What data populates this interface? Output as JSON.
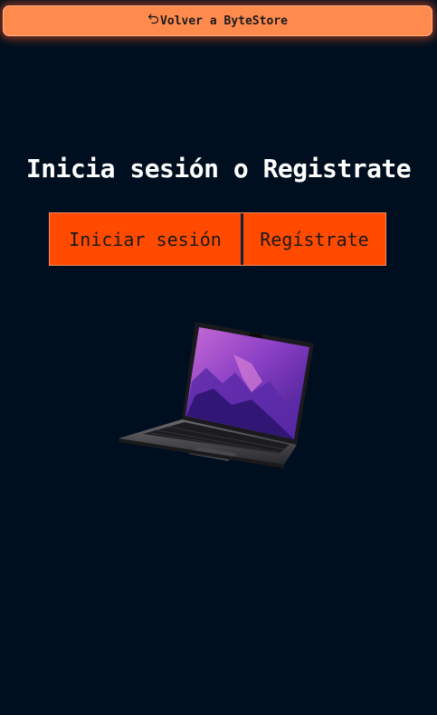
{
  "back_button": {
    "label": "Volver a ByteStore",
    "icon": "undo-arrow-icon"
  },
  "title": "Inicia sesión o Registrate",
  "auth_toggle": {
    "options": [
      {
        "label": "Iniciar sesión"
      },
      {
        "label": "Regístrate"
      }
    ]
  },
  "hero_image": {
    "subject": "laptop"
  },
  "colors": {
    "background": "#000f1f",
    "back_button": "#ff8a4e",
    "toggle": "#ff4a00",
    "title_text": "#ffffff"
  }
}
